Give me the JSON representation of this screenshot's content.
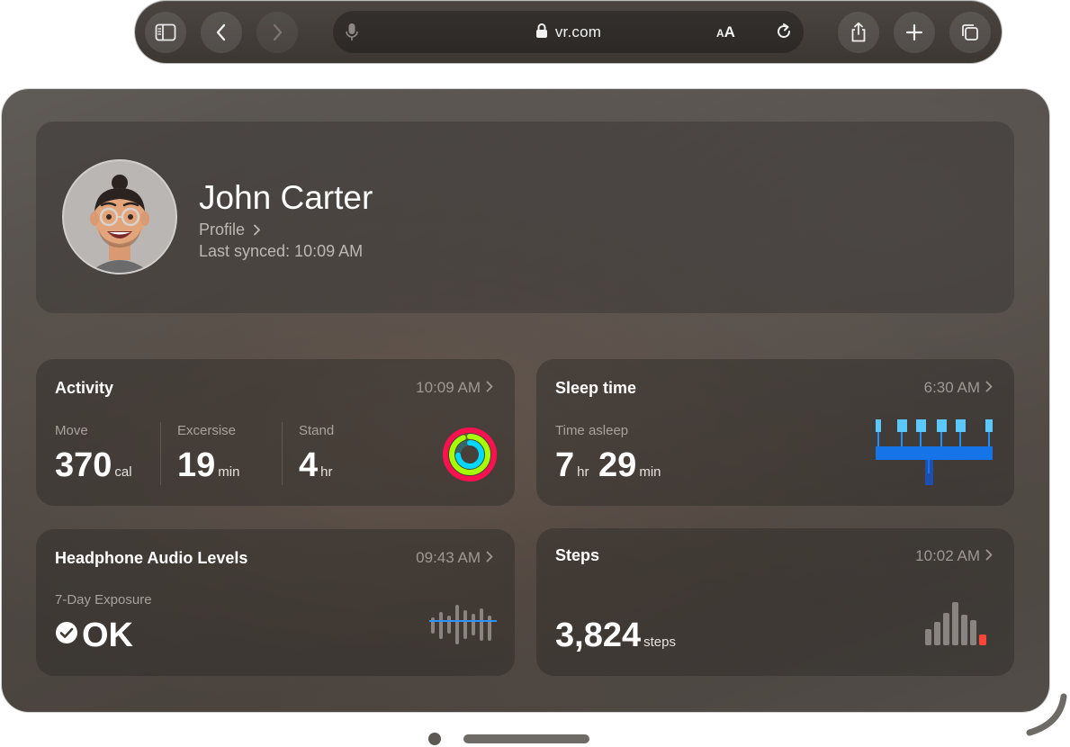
{
  "browser": {
    "url": "vr.com",
    "text_size_label": "AA",
    "icons": {
      "sidebar": "sidebar-icon",
      "back": "chevron-left-icon",
      "forward": "chevron-right-icon",
      "mic": "microphone-icon",
      "lock": "lock-icon",
      "reload": "reload-icon",
      "share": "share-icon",
      "new_tab": "plus-icon",
      "tabs": "tabs-icon"
    }
  },
  "profile": {
    "name": "John Carter",
    "profile_link": "Profile",
    "last_synced": "Last synced: 10:09 AM"
  },
  "activity": {
    "title": "Activity",
    "time": "10:09 AM",
    "move": {
      "label": "Move",
      "value": "370",
      "unit": "cal"
    },
    "exercise": {
      "label": "Excersise",
      "value": "19",
      "unit": "min"
    },
    "stand": {
      "label": "Stand",
      "value": "4",
      "unit": "hr"
    },
    "ring_colors": {
      "move": "#fa114f",
      "exercise": "#a6ff00",
      "stand": "#00d7ff"
    }
  },
  "sleep": {
    "title": "Sleep time",
    "time": "6:30 AM",
    "label": "Time asleep",
    "hours": "7",
    "hours_unit": "hr",
    "minutes": "29",
    "minutes_unit": "min",
    "color": "#1e90ff"
  },
  "audio": {
    "title": "Headphone Audio Levels",
    "time": "09:43 AM",
    "label": "7-Day Exposure",
    "status": "OK"
  },
  "steps": {
    "title": "Steps",
    "time": "10:02 AM",
    "value": "3,824",
    "unit": "steps",
    "accent": "#ff453a"
  }
}
